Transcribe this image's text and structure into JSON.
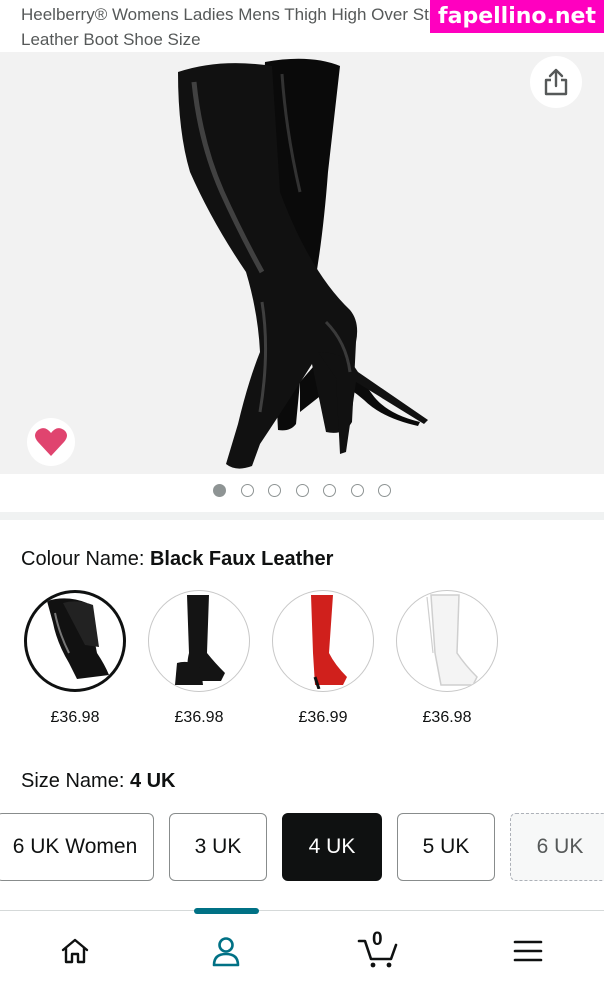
{
  "product": {
    "title": "Heelberry® Womens Ladies Mens Thigh High Over Stretch Suede Leather Boot Shoe Size"
  },
  "watermark": "fapellino.net",
  "gallery": {
    "image_count": 7,
    "active_index": 0,
    "favorited": true,
    "heart_color": "#e0446f",
    "share_icon": "share-icon"
  },
  "colour": {
    "label": "Colour Name:",
    "selected": "Black Faux Leather",
    "options": [
      {
        "name": "Black Faux Leather",
        "price": "£36.98",
        "color": "#111111",
        "selected": true
      },
      {
        "name": "Black",
        "price": "£36.98",
        "color": "#141414",
        "selected": false
      },
      {
        "name": "Red",
        "price": "£36.99",
        "color": "#d0201c",
        "selected": false
      },
      {
        "name": "White",
        "price": "£36.98",
        "color": "#f4f4f4",
        "selected": false
      }
    ]
  },
  "size": {
    "label": "Size Name:",
    "selected": "4 UK",
    "options": [
      {
        "label": "6 UK Women",
        "state": "available"
      },
      {
        "label": "3 UK",
        "state": "available"
      },
      {
        "label": "4 UK",
        "state": "selected"
      },
      {
        "label": "5 UK",
        "state": "available"
      },
      {
        "label": "6 UK",
        "state": "unavailable"
      }
    ]
  },
  "nav": {
    "active": "account",
    "cart_count": "0",
    "items": [
      "home-icon",
      "account-icon",
      "cart-icon",
      "menu-icon"
    ],
    "accent": "#007185"
  }
}
